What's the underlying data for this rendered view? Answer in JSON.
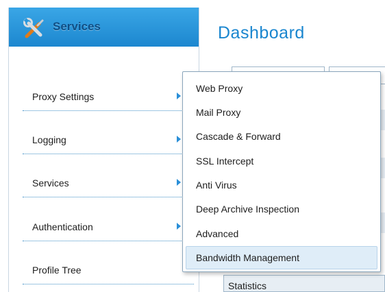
{
  "sidebar": {
    "title": "Services",
    "icon": "tools-icon",
    "items": [
      {
        "label": "Proxy Settings",
        "has_submenu": true
      },
      {
        "label": "Logging",
        "has_submenu": true
      },
      {
        "label": "Services",
        "has_submenu": true
      },
      {
        "label": "Authentication",
        "has_submenu": true
      },
      {
        "label": "Profile Tree",
        "has_submenu": false
      }
    ]
  },
  "main": {
    "title": "Dashboard",
    "statistics_label": "Statistics"
  },
  "dropdown": {
    "items": [
      {
        "label": "Web Proxy"
      },
      {
        "label": "Mail Proxy"
      },
      {
        "label": "Cascade & Forward"
      },
      {
        "label": "SSL Intercept"
      },
      {
        "label": "Anti Virus"
      },
      {
        "label": "Deep Archive Inspection"
      },
      {
        "label": "Advanced"
      },
      {
        "label": "Bandwidth Management"
      }
    ],
    "selected_label": "Bandwidth Management"
  },
  "colors": {
    "accent": "#1a86cf",
    "header_bg": "#2a97dc",
    "selected_bg": "#dfedf8"
  }
}
